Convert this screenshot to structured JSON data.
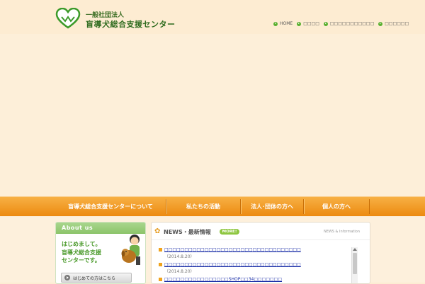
{
  "header": {
    "logo_small": "一般社団法人",
    "logo_name": "盲導犬総合支援センター"
  },
  "topnav": [
    "HOME",
    "□□□□",
    "□□□□□□□□□□□",
    "□□□□□□"
  ],
  "mainnav": [
    "盲導犬総合支援センターについて",
    "私たちの活動",
    "法人･団体の方へ",
    "個人の方へ"
  ],
  "about": {
    "heading": "About us",
    "text_lines": [
      "はじめまして。",
      "盲導犬総合支援",
      "センターです。"
    ],
    "button_label": "はじめての方はこちら"
  },
  "news": {
    "title": "NEWS・最新情報",
    "more": "MORE!",
    "subtitle": "NEWS & Information",
    "items": [
      {
        "title": "□□□□□□□□□□□□□□□□□□□□□□□□□□□□□□□□□□",
        "date": "（2014.8.20）"
      },
      {
        "title": "□□□□□□□□□□□□□□□□□□□□□□□□□□□□□□□□□□",
        "date": "（2014.8.20）"
      },
      {
        "title": "□□□□□□□□□□□□□□□□SHOP□□34□□□□□□□",
        "date": ""
      }
    ]
  },
  "colors": {
    "accent_green": "#5ab031",
    "nav_orange": "#ec8a10",
    "link_blue": "#1b2fa8",
    "background": "#fdecd2"
  }
}
